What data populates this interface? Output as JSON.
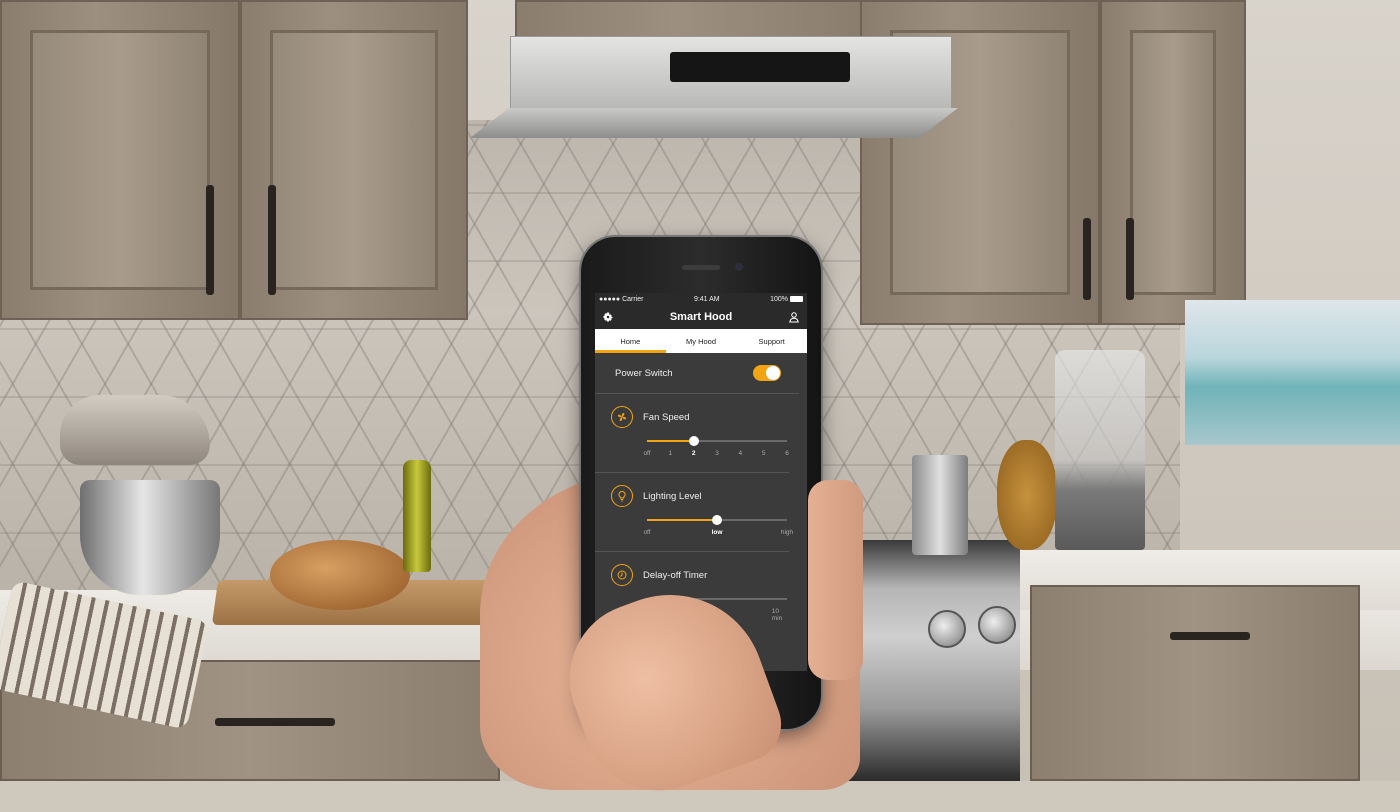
{
  "status_bar": {
    "carrier": "●●●●● Carrier",
    "time": "9:41 AM",
    "battery": "100%"
  },
  "app": {
    "title": "Smart Hood"
  },
  "tabs": [
    {
      "label": "Home",
      "active": true
    },
    {
      "label": "My Hood",
      "active": false
    },
    {
      "label": "Support",
      "active": false
    }
  ],
  "power": {
    "label": "Power Switch",
    "on": true
  },
  "fan": {
    "label": "Fan Speed",
    "value": 2,
    "ticks": [
      "off",
      "1",
      "2",
      "3",
      "4",
      "5",
      "6"
    ],
    "selected_tick": "2"
  },
  "lighting": {
    "label": "Lighting Level",
    "value": "low",
    "ticks": [
      "off",
      "low",
      "high"
    ],
    "selected_tick": "low"
  },
  "timer": {
    "label": "Delay-off Timer",
    "end_tick": "10 min"
  },
  "colors": {
    "accent": "#f2a413",
    "screen_bg": "#3b3b3b",
    "nav_bg": "#2a2a2a"
  },
  "icons": {
    "settings": "gear-icon",
    "account": "user-icon",
    "fan": "fan-icon",
    "light": "lightbulb-icon",
    "timer": "clock-icon"
  }
}
